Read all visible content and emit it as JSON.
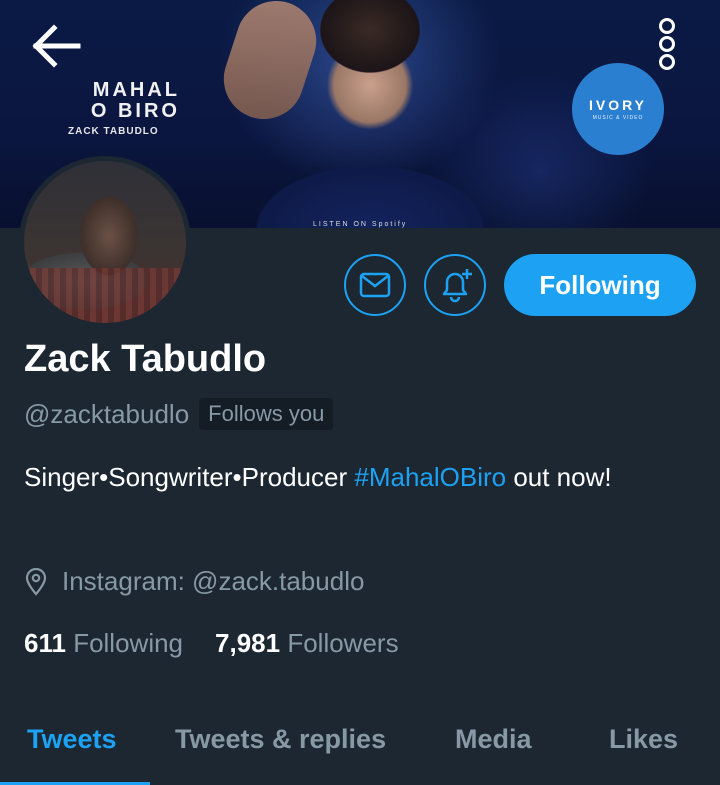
{
  "banner": {
    "album_title_line1": "MAHAL",
    "album_title_line2": "O BIRO",
    "album_artist": "ZACK TABUDLO",
    "listen_on": "LISTEN ON Spotify",
    "label_logo": "IVORY",
    "label_sub": "MUSIC & VIDEO"
  },
  "icons": {
    "back": "arrow-left-icon",
    "more": "more-vertical-icon",
    "message": "envelope-icon",
    "notify": "bell-plus-icon",
    "location": "location-pin-icon"
  },
  "actions": {
    "follow_label": "Following"
  },
  "profile": {
    "display_name": "Zack Tabudlo",
    "handle": "@zacktabudlo",
    "follows_you": "Follows you",
    "bio_text_before": "Singer•Songwriter•Producer ",
    "bio_hashtag": "#MahalOBiro",
    "bio_text_after": " out now!",
    "location": "Instagram: @zack.tabudlo",
    "following_count": "611",
    "following_label": "Following",
    "followers_count": "7,981",
    "followers_label": "Followers"
  },
  "tabs": [
    {
      "label": "Tweets",
      "active": true
    },
    {
      "label": "Tweets & replies",
      "active": false
    },
    {
      "label": "Media",
      "active": false
    },
    {
      "label": "Likes",
      "active": false
    }
  ],
  "colors": {
    "background": "#1c2732",
    "accent": "#1da1f2",
    "secondary_text": "#8899a6",
    "primary_text": "#ffffff"
  }
}
